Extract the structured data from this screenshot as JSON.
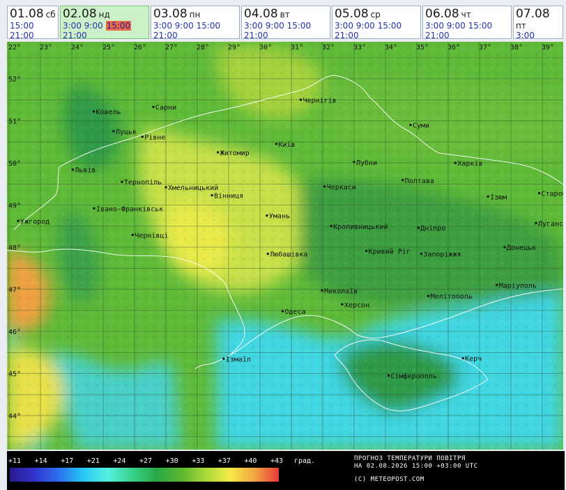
{
  "days": [
    {
      "date": "01.08",
      "name": "сб",
      "times": [
        "15:00",
        "21:00"
      ]
    },
    {
      "date": "02.08",
      "name": "нд",
      "times": [
        "3:00",
        "9:00",
        "15:00",
        "21:00"
      ],
      "active": true,
      "selected": "15:00"
    },
    {
      "date": "03.08",
      "name": "пн",
      "times": [
        "3:00",
        "9:00",
        "15:00",
        "21:00"
      ]
    },
    {
      "date": "04.08",
      "name": "вт",
      "times": [
        "3:00",
        "9:00",
        "15:00",
        "21:00"
      ]
    },
    {
      "date": "05.08",
      "name": "ср",
      "times": [
        "3:00",
        "9:00",
        "15:00",
        "21:00"
      ]
    },
    {
      "date": "06.08",
      "name": "чт",
      "times": [
        "3:00",
        "9:00",
        "15:00",
        "21:00"
      ]
    },
    {
      "date": "07.08",
      "name": "пт",
      "times": [
        "3:00"
      ]
    }
  ],
  "map": {
    "longitudes": [
      "22°",
      "23°",
      "24°",
      "25°",
      "26°",
      "27°",
      "28°",
      "29°",
      "30°",
      "31°",
      "32°",
      "33°",
      "34°",
      "35°",
      "36°",
      "37°",
      "38°",
      "39°"
    ],
    "latitudes": [
      "52°",
      "51°",
      "50°",
      "49°",
      "48°",
      "47°",
      "46°",
      "45°",
      "44°"
    ],
    "cities": [
      {
        "name": "Чернігів",
        "lon": 31.3,
        "lat": 51.5
      },
      {
        "name": "Сарни",
        "lon": 26.6,
        "lat": 51.33
      },
      {
        "name": "Ковель",
        "lon": 24.7,
        "lat": 51.22
      },
      {
        "name": "Суми",
        "lon": 34.8,
        "lat": 50.9
      },
      {
        "name": "Луцьк",
        "lon": 25.33,
        "lat": 50.75
      },
      {
        "name": "Рівне",
        "lon": 26.25,
        "lat": 50.62
      },
      {
        "name": "Київ",
        "lon": 30.52,
        "lat": 50.45
      },
      {
        "name": "Житомир",
        "lon": 28.66,
        "lat": 50.25
      },
      {
        "name": "Лубни",
        "lon": 33.0,
        "lat": 50.02
      },
      {
        "name": "Харків",
        "lon": 36.23,
        "lat": 50.0
      },
      {
        "name": "Львів",
        "lon": 24.03,
        "lat": 49.84
      },
      {
        "name": "Тернопіль",
        "lon": 25.6,
        "lat": 49.55
      },
      {
        "name": "Полтава",
        "lon": 34.55,
        "lat": 49.59
      },
      {
        "name": "Черкаси",
        "lon": 32.06,
        "lat": 49.44
      },
      {
        "name": "Хмельницький",
        "lon": 27.0,
        "lat": 49.42
      },
      {
        "name": "Старобільськ",
        "lon": 38.9,
        "lat": 49.28
      },
      {
        "name": "Вінниця",
        "lon": 28.47,
        "lat": 49.23
      },
      {
        "name": "Ізюм",
        "lon": 37.27,
        "lat": 49.2
      },
      {
        "name": "Івано-Франківськ",
        "lon": 24.71,
        "lat": 48.92
      },
      {
        "name": "Ужгород",
        "lon": 22.29,
        "lat": 48.62
      },
      {
        "name": "Умань",
        "lon": 30.22,
        "lat": 48.75
      },
      {
        "name": "Луганськ",
        "lon": 38.8,
        "lat": 48.57
      },
      {
        "name": "Кропивницький",
        "lon": 32.27,
        "lat": 48.5
      },
      {
        "name": "Дніпро",
        "lon": 35.05,
        "lat": 48.46
      },
      {
        "name": "Чернівці",
        "lon": 25.94,
        "lat": 48.29
      },
      {
        "name": "Донецьк",
        "lon": 37.8,
        "lat": 48.0
      },
      {
        "name": "Кривий Ріг",
        "lon": 33.39,
        "lat": 47.91
      },
      {
        "name": "Запоріжжя",
        "lon": 35.14,
        "lat": 47.84
      },
      {
        "name": "Любашівка",
        "lon": 30.25,
        "lat": 47.84
      },
      {
        "name": "Маріуполь",
        "lon": 37.55,
        "lat": 47.1
      },
      {
        "name": "Миколаїв",
        "lon": 31.98,
        "lat": 46.97
      },
      {
        "name": "Мелітополь",
        "lon": 35.37,
        "lat": 46.84
      },
      {
        "name": "Херсон",
        "lon": 32.62,
        "lat": 46.64
      },
      {
        "name": "Одеса",
        "lon": 30.72,
        "lat": 46.48
      },
      {
        "name": "Керч",
        "lon": 36.47,
        "lat": 45.36
      },
      {
        "name": "Ізмаїл",
        "lon": 28.84,
        "lat": 45.35
      },
      {
        "name": "Сімферополь",
        "lon": 34.1,
        "lat": 44.95
      }
    ]
  },
  "legend": {
    "ticks": [
      "+11",
      "+14",
      "+17",
      "+21",
      "+24",
      "+27",
      "+30",
      "+33",
      "+37",
      "+40",
      "+43"
    ],
    "unit": "град.",
    "colors": [
      "#2a1a8e",
      "#3333cc",
      "#2b6ff0",
      "#26c8f5",
      "#55f0e0",
      "#38d28a",
      "#27a845",
      "#5ab52f",
      "#a8d83a",
      "#f5ec45",
      "#f4a542",
      "#e8383a"
    ]
  },
  "info": {
    "line1": "ПРОГНОЗ ТЕМПЕРАТУРИ ПОВІТРЯ",
    "line2": "НА 02.08.2026 15:00 +03:00 UTC",
    "line3": "(C) METEOPOST.COM"
  },
  "colors": {
    "sea": "#3fd6e2",
    "hot": "#f0b24a",
    "warm": "#c8e048",
    "mild": "#8cc93a",
    "cool": "#3fa448",
    "cold": "#1f8a3e"
  }
}
